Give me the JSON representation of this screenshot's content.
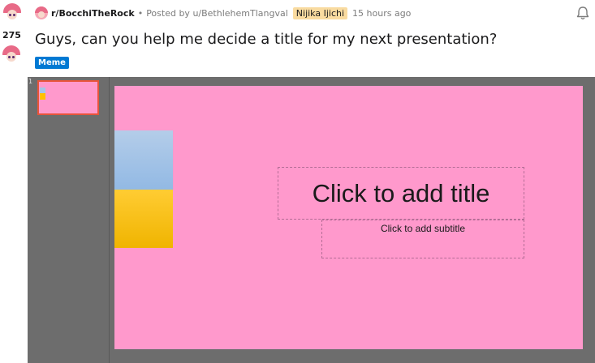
{
  "post": {
    "vote_count": "275",
    "subreddit": "r/BocchiTheRock",
    "separator": "•",
    "posted_by": "Posted by u/BethlehemTlangval",
    "user_flair": "Nijika Ijichi",
    "timestamp": "15 hours ago",
    "title": "Guys, can you help me decide a title for my next presentation?",
    "post_flair": "Meme"
  },
  "editor": {
    "slide_number": "1",
    "title_placeholder": "Click to add title",
    "subtitle_placeholder": "Click to add subtitle"
  },
  "icons": {
    "bell": "bell-icon",
    "subreddit": "subreddit-avatar-icon",
    "upvote": "nijika-upvote-icon",
    "downvote": "nijika-downvote-icon"
  },
  "colors": {
    "slide_background": "#ff99cc",
    "flag_blue": "#a6c4e7",
    "flag_yellow": "#ffc000",
    "flair_background": "#f9dba0",
    "post_flair_background": "#0079d3",
    "editor_background": "#6d6d6d"
  }
}
